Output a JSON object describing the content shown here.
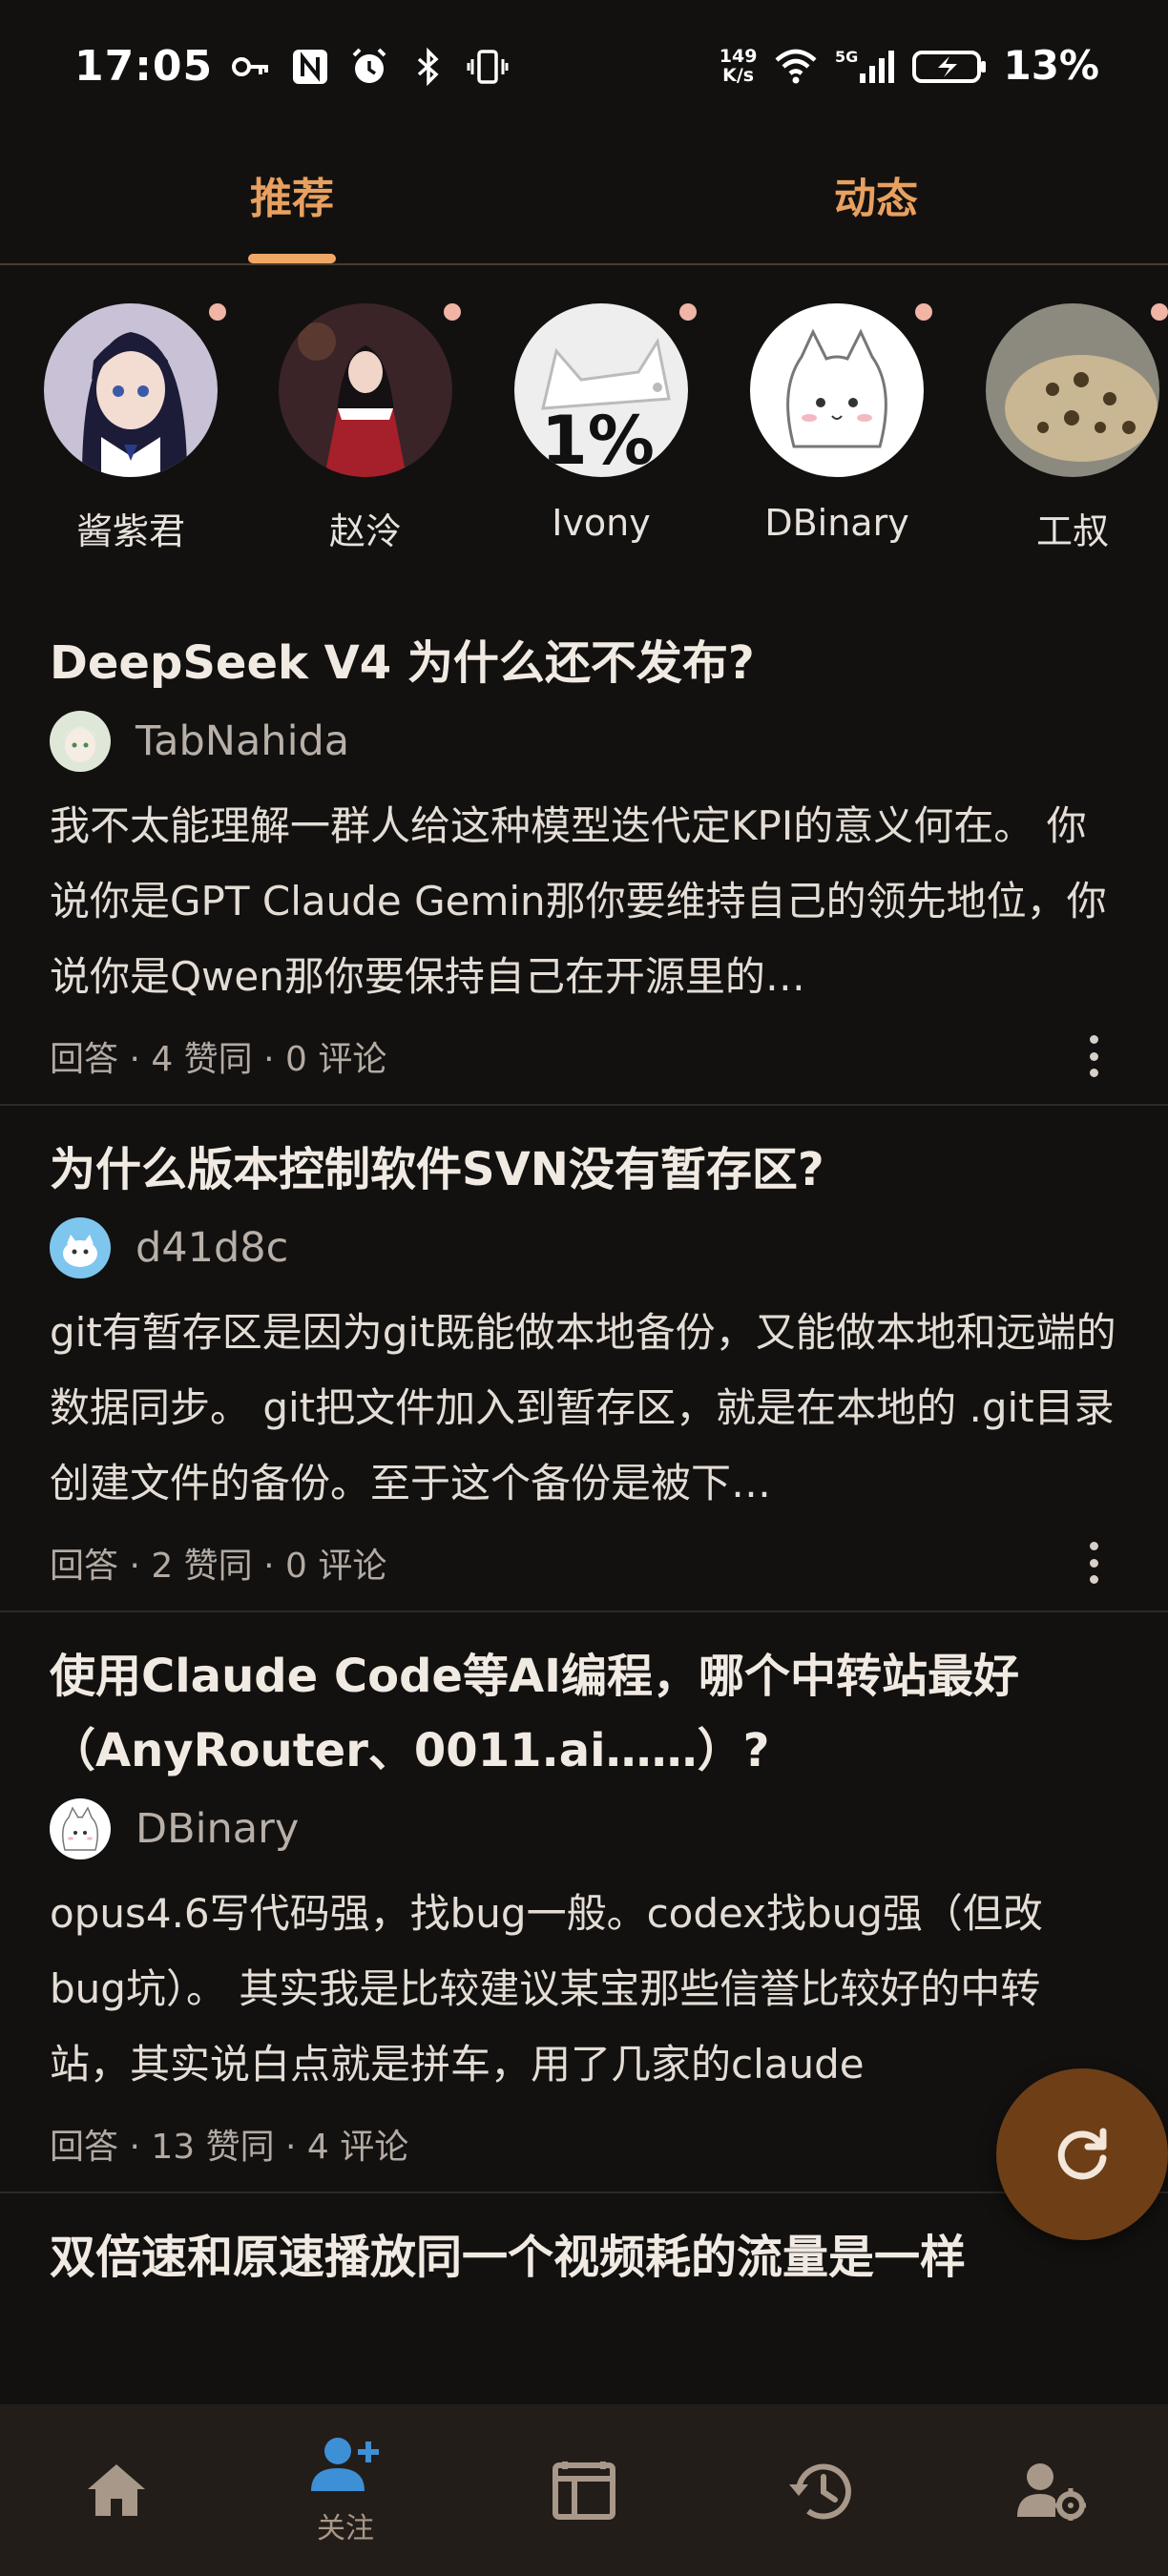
{
  "status_bar": {
    "time": "17:05",
    "net_speed_value": "149",
    "net_speed_unit": "K/s",
    "network": "5G",
    "battery": "13%"
  },
  "top_tabs": [
    {
      "label": "推荐",
      "active": true
    },
    {
      "label": "动态",
      "active": false
    }
  ],
  "stories": [
    {
      "name": "酱紫君",
      "avatar": "anime-girl-avatar"
    },
    {
      "name": "赵泠",
      "avatar": "red-dress-girl-avatar"
    },
    {
      "name": "Ivony",
      "avatar": "one-percent-cat-avatar"
    },
    {
      "name": "DBinary",
      "avatar": "white-fox-avatar"
    },
    {
      "name": "工叔",
      "avatar": "leopard-avatar"
    }
  ],
  "feed": [
    {
      "title": "DeepSeek V4 为什么还不发布?",
      "author": "TabNahida",
      "excerpt": "我不太能理解一群人给这种模型迭代定KPI的意义何在。 你说你是GPT Claude Gemin那你要维持自己的领先地位，你说你是Qwen那你要保持自己在开源里的…",
      "meta": "回答 · 4 赞同 · 0 评论"
    },
    {
      "title": "为什么版本控制软件SVN没有暂存区?",
      "author": "d41d8c",
      "excerpt": "git有暂存区是因为git既能做本地备份，又能做本地和远端的数据同步。 git把文件加入到暂存区，就是在本地的 .git目录创建文件的备份。至于这个备份是被下…",
      "meta": "回答 · 2 赞同 · 0 评论"
    },
    {
      "title": "使用Claude Code等AI编程，哪个中转站最好（AnyRouter、0011.ai……）?",
      "author": "DBinary",
      "excerpt": "opus4.6写代码强，找bug一般。codex找bug强（但改bug坑）。 其实我是比较建议某宝那些信誉比较好的中转站，其实说白点就是拼车，用了几家的claude",
      "meta": "回答 · 13 赞同 · 4 评论"
    },
    {
      "title": "双倍速和原速播放同一个视频耗的流量是一样",
      "author": "",
      "excerpt": "",
      "meta": ""
    }
  ],
  "bottom_nav": [
    {
      "icon": "home-icon",
      "label": ""
    },
    {
      "icon": "follow-icon",
      "label": "关注"
    },
    {
      "icon": "calendar-icon",
      "label": ""
    },
    {
      "icon": "history-icon",
      "label": ""
    },
    {
      "icon": "user-settings-icon",
      "label": ""
    }
  ],
  "colors": {
    "background": "#121110",
    "accent": "#f0a765",
    "fab": "#6e3f16",
    "nav_bg": "#231d19"
  }
}
